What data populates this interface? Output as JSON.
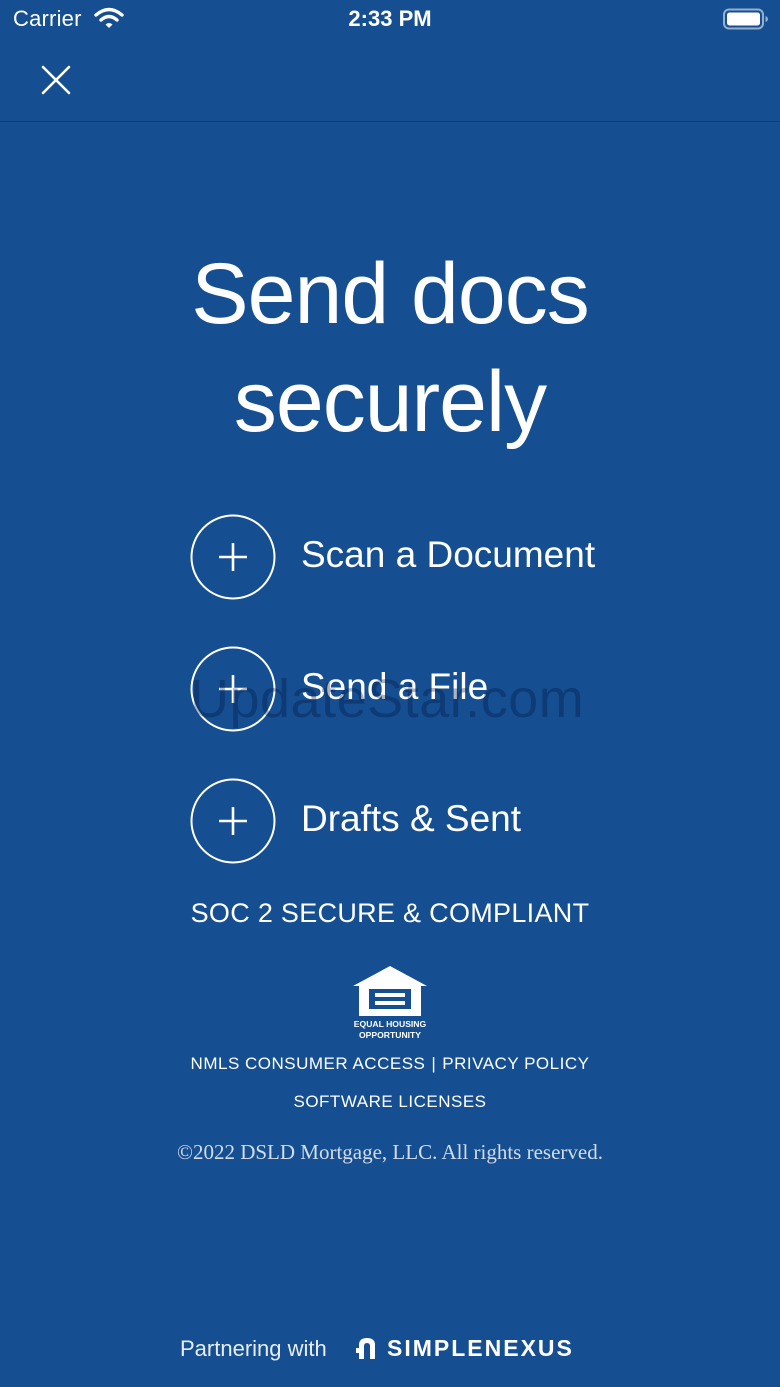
{
  "status_bar": {
    "carrier": "Carrier",
    "time": "2:33 PM",
    "icons": [
      "wifi-icon",
      "battery-icon"
    ]
  },
  "nav": {
    "close_icon": "close-icon"
  },
  "headline": {
    "line1": "Send docs",
    "line2": "securely"
  },
  "actions": [
    {
      "icon": "plus-icon",
      "label": "Scan a Document"
    },
    {
      "icon": "plus-icon",
      "label": "Send a File"
    },
    {
      "icon": "plus-icon",
      "label": "Drafts & Sent"
    }
  ],
  "compliance": {
    "soc": "SOC 2 SECURE & COMPLIANT",
    "housing_logo_text": [
      "EQUAL HOUSING",
      "OPPORTUNITY"
    ]
  },
  "links": {
    "nmls": "NMLS CONSUMER ACCESS",
    "separator": "|",
    "privacy": "PRIVACY POLICY",
    "licenses": "SOFTWARE LICENSES"
  },
  "copyright": "©2022 DSLD Mortgage, LLC. All rights reserved.",
  "partner": {
    "prefix": "Partnering with",
    "brand": "SIMPLENEXUS"
  },
  "watermark": "UpdateStar.com",
  "colors": {
    "background": "#154f91",
    "foreground": "#ffffff"
  }
}
